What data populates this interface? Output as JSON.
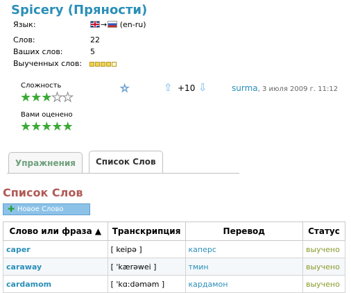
{
  "header": {
    "title": "Spicery (Пряности)"
  },
  "info": {
    "language_label": "Язык:",
    "language_code": "(en-ru)",
    "words_label": "Слов:",
    "words_value": "22",
    "your_words_label": "Ваших слов:",
    "your_words_value": "5",
    "learned_label": "Выученных слов:",
    "learned_progress": {
      "filled": 4,
      "total": 5
    }
  },
  "rating": {
    "difficulty_label": "Сложность",
    "difficulty_stars": {
      "filled": 3,
      "total": 5
    },
    "your_rating_label": "Вами оценено",
    "your_rating_stars": {
      "filled": 5,
      "total": 5
    },
    "score": "+10",
    "author": "surma",
    "date": ", 3 июля 2009 г. 11:12"
  },
  "tabs": [
    {
      "label": "Упражнения",
      "active": false
    },
    {
      "label": "Список Слов",
      "active": true
    }
  ],
  "section": {
    "title": "Список Слов",
    "new_word_button": "Новое Слово"
  },
  "table": {
    "headers": [
      "Слово или фраза ▲",
      "Транскрипция",
      "Перевод",
      "Статус"
    ],
    "rows": [
      {
        "word": "caper",
        "transcription": "[ keipə ]",
        "translation": "каперс",
        "status": "выучено"
      },
      {
        "word": "caraway",
        "transcription": "[ 'kærəwei ]",
        "translation": "тмин",
        "status": "выучено"
      },
      {
        "word": "cardamom",
        "transcription": "[ 'kɑ:dəməm ]",
        "translation": "кардамон",
        "status": "выучено"
      }
    ]
  },
  "colors": {
    "accent": "#2a8fb8",
    "star_green": "#3aa935",
    "section_title": "#b05a56",
    "status": "#8a9a2a"
  },
  "icons": [
    "uk-flag-icon",
    "ru-flag-icon",
    "star-icon",
    "up-arrow-icon",
    "down-arrow-icon",
    "plus-icon"
  ]
}
